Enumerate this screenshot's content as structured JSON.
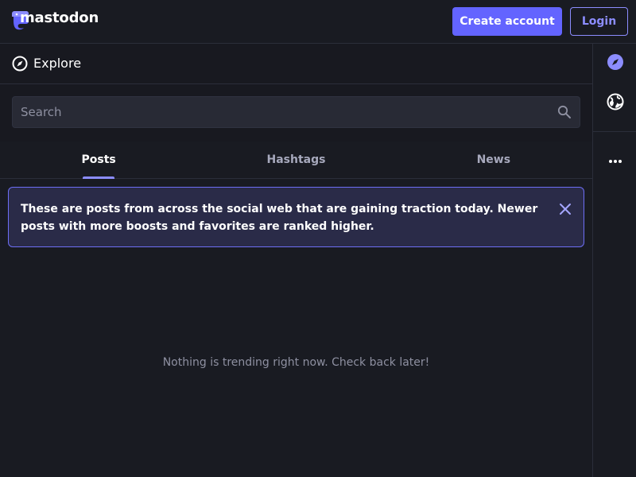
{
  "topbar": {
    "logo_text": "mastodon",
    "create_account_label": "Create account",
    "login_label": "Login"
  },
  "explore": {
    "title": "Explore",
    "icon": "compass-icon"
  },
  "search": {
    "placeholder": "Search",
    "value": "",
    "icon": "search-icon"
  },
  "tabs": [
    {
      "label": "Posts",
      "active": true
    },
    {
      "label": "Hashtags",
      "active": false
    },
    {
      "label": "News",
      "active": false
    }
  ],
  "notice": {
    "text": "These are posts from across the social web that are gaining traction today. Newer posts with more boosts and favorites are ranked higher.",
    "close_icon": "close-icon"
  },
  "empty_message": "Nothing is trending right now. Check back later!",
  "rail": {
    "items": [
      "compass-icon",
      "globe-icon",
      "more-icon"
    ]
  },
  "colors": {
    "accent": "#6364ff",
    "accent_light": "#8c8dff",
    "background": "#191b22",
    "notice_bg": "#2a2b48",
    "muted_text": "#8e90a1"
  }
}
